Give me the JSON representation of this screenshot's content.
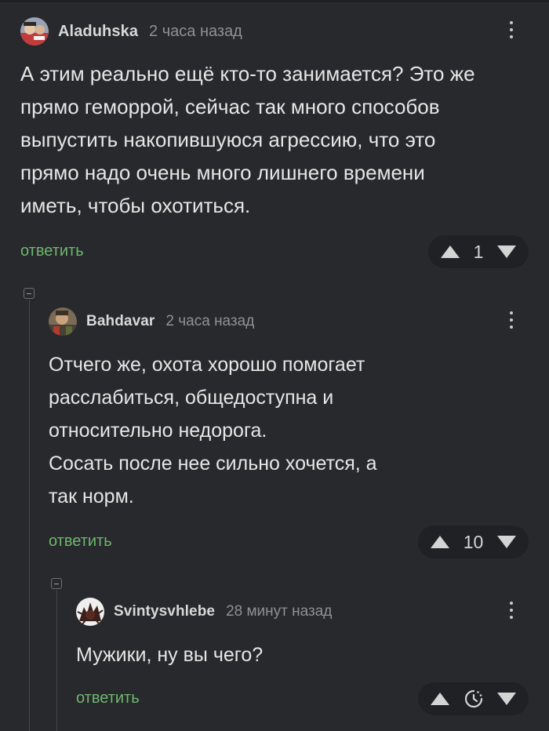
{
  "comments": [
    {
      "author": "Aladuhska",
      "time": "2 часа назад",
      "lines": [
        "А этим реально ещё кто-то занимается? Это же",
        "прямо геморрой, сейчас так много способов",
        "выпустить накопившуюся агрессию, что это",
        "прямо надо очень много лишнего времени",
        "иметь, чтобы охотиться."
      ],
      "reply_label": "ответить",
      "score": "1"
    },
    {
      "author": "Bahdavar",
      "time": "2 часа назад",
      "lines": [
        "Отчего же, охота хорошо помогает",
        "расслабиться, общедоступна и",
        "относительно недорога.",
        "Сосать после нее сильно хочется, а",
        "так норм."
      ],
      "reply_label": "ответить",
      "score": "10"
    },
    {
      "author": "Svintysvhlebe",
      "time": "28 минут назад",
      "lines": [
        "Мужики, ну вы чего?"
      ],
      "reply_label": "ответить",
      "score_icon": "clock-hidden-rating-icon"
    }
  ],
  "icons": {
    "more": "more-vertical-icon",
    "upvote": "upvote-icon",
    "downvote": "downvote-icon",
    "collapse": "collapse-thread-icon"
  },
  "colors": {
    "background": "#27292c",
    "reply": "#6fb66f",
    "meta": "#8e9196"
  }
}
